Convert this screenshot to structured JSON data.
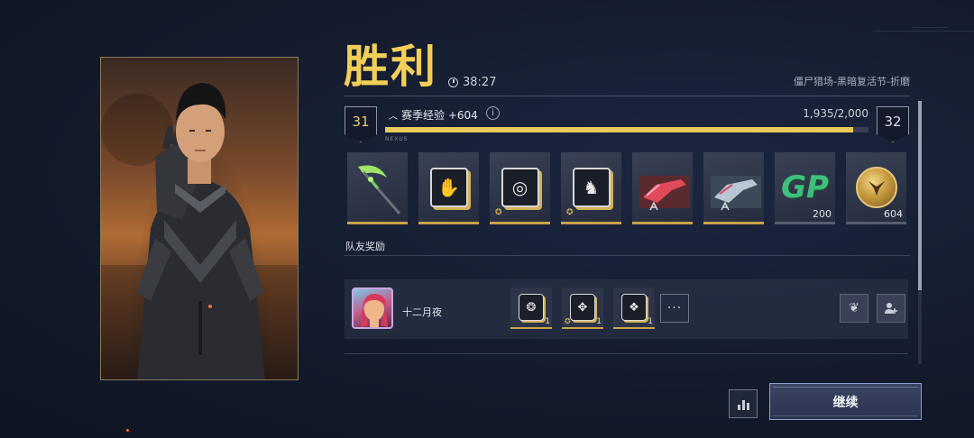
{
  "header": {
    "result": "胜利",
    "duration": "38:27",
    "mode": "僵尸猎场-黑暗复活节-折磨"
  },
  "level": {
    "current": "31",
    "next": "32",
    "exp_label": "赛季经验 +604",
    "exp_value": "1,935/2,000",
    "progress_fraction": 0.9675,
    "tag": "NEXUS"
  },
  "rewards": [
    {
      "name": "scythe-weapon",
      "qty": ""
    },
    {
      "name": "hand-card",
      "qty": ""
    },
    {
      "name": "circle-card",
      "qty": ""
    },
    {
      "name": "bell-card",
      "qty": ""
    },
    {
      "name": "red-rifle-skin",
      "qty": ""
    },
    {
      "name": "blue-rifle-skin",
      "qty": ""
    },
    {
      "name": "gp-currency",
      "label": "GP",
      "qty": "200"
    },
    {
      "name": "gold-coin",
      "qty": "604"
    }
  ],
  "team": {
    "label": "队友奖励",
    "mate_name": "十二月夜",
    "items": [
      {
        "name": "card-1",
        "qty": "1"
      },
      {
        "name": "card-2",
        "qty": "1"
      },
      {
        "name": "card-3",
        "qty": "1"
      }
    ],
    "more": "···"
  },
  "footer": {
    "continue_label": "继续"
  },
  "colors": {
    "title_gold": "#f2cf57",
    "bar_fill": "#e8cb5b",
    "gp_green": "#3ec07a"
  }
}
